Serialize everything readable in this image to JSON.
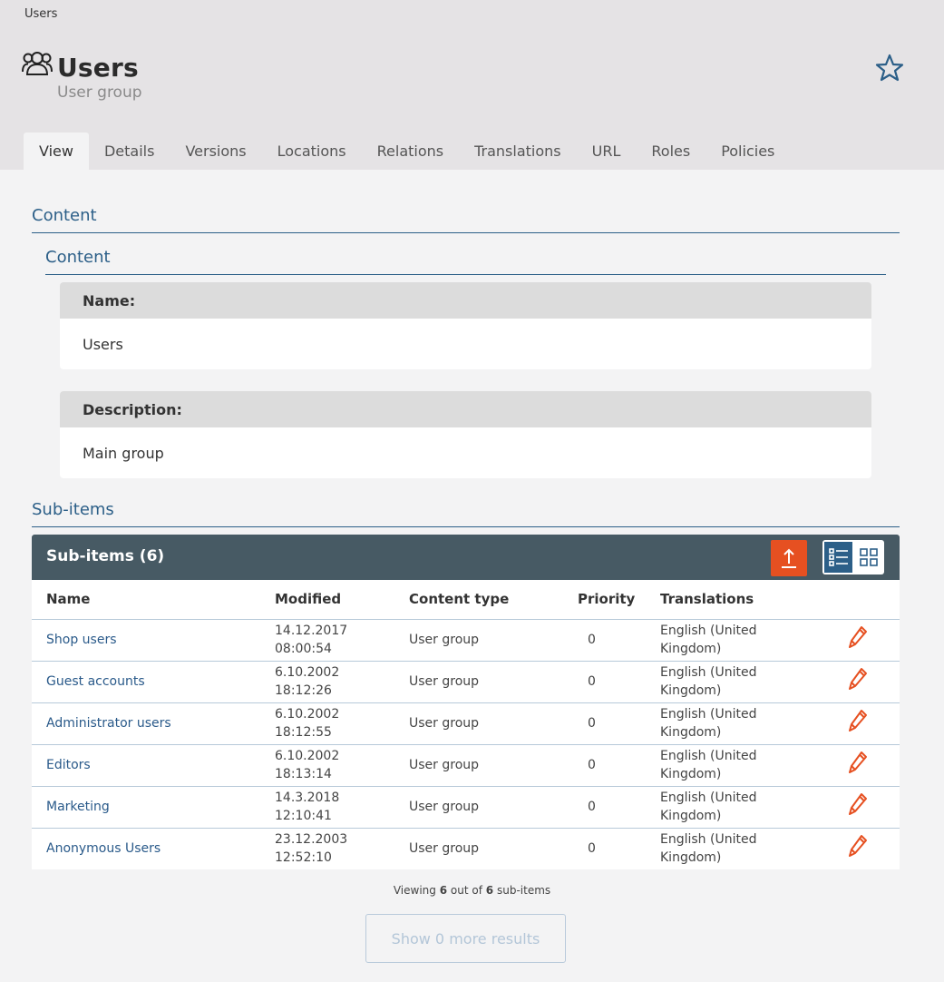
{
  "breadcrumb": "Users",
  "header": {
    "title": "Users",
    "subtitle": "User group",
    "icon": "users-group-icon",
    "bookmark_icon": "star-icon"
  },
  "tabs": [
    {
      "label": "View",
      "active": true
    },
    {
      "label": "Details"
    },
    {
      "label": "Versions"
    },
    {
      "label": "Locations"
    },
    {
      "label": "Relations"
    },
    {
      "label": "Translations"
    },
    {
      "label": "URL"
    },
    {
      "label": "Roles"
    },
    {
      "label": "Policies"
    }
  ],
  "content": {
    "section_title": "Content",
    "group_title": "Content",
    "fields": [
      {
        "label": "Name:",
        "value": "Users"
      },
      {
        "label": "Description:",
        "value": "Main group"
      }
    ]
  },
  "subitems": {
    "section_title": "Sub-items",
    "panel_title": "Sub-items (6)",
    "columns": [
      "Name",
      "Modified",
      "Content type",
      "Priority",
      "Translations"
    ],
    "rows": [
      {
        "name": "Shop users",
        "modified_date": "14.12.2017",
        "modified_time": "08:00:54",
        "content_type": "User group",
        "priority": "0",
        "translation_line1": "English (United",
        "translation_line2": "Kingdom)"
      },
      {
        "name": "Guest accounts",
        "modified_date": "6.10.2002",
        "modified_time": "18:12:26",
        "content_type": "User group",
        "priority": "0",
        "translation_line1": "English (United",
        "translation_line2": "Kingdom)"
      },
      {
        "name": "Administrator users",
        "modified_date": "6.10.2002",
        "modified_time": "18:12:55",
        "content_type": "User group",
        "priority": "0",
        "translation_line1": "English (United",
        "translation_line2": "Kingdom)"
      },
      {
        "name": "Editors",
        "modified_date": "6.10.2002",
        "modified_time": "18:13:14",
        "content_type": "User group",
        "priority": "0",
        "translation_line1": "English (United",
        "translation_line2": "Kingdom)"
      },
      {
        "name": "Marketing",
        "modified_date": "14.3.2018",
        "modified_time": "12:10:41",
        "content_type": "User group",
        "priority": "0",
        "translation_line1": "English (United",
        "translation_line2": "Kingdom)"
      },
      {
        "name": "Anonymous Users",
        "modified_date": "23.12.2003",
        "modified_time": "12:52:10",
        "content_type": "User group",
        "priority": "0",
        "translation_line1": "English (United",
        "translation_line2": "Kingdom)"
      }
    ],
    "viewing_prefix": "Viewing",
    "viewing_shown": "6",
    "viewing_middle": "out of",
    "viewing_total": "6",
    "viewing_suffix": "sub-items",
    "more_button": "Show 0 more results"
  },
  "colors": {
    "header_bg": "#e5e3e5",
    "accent": "#2c5f88",
    "panel_header": "#475a64",
    "action_orange": "#e65021"
  }
}
